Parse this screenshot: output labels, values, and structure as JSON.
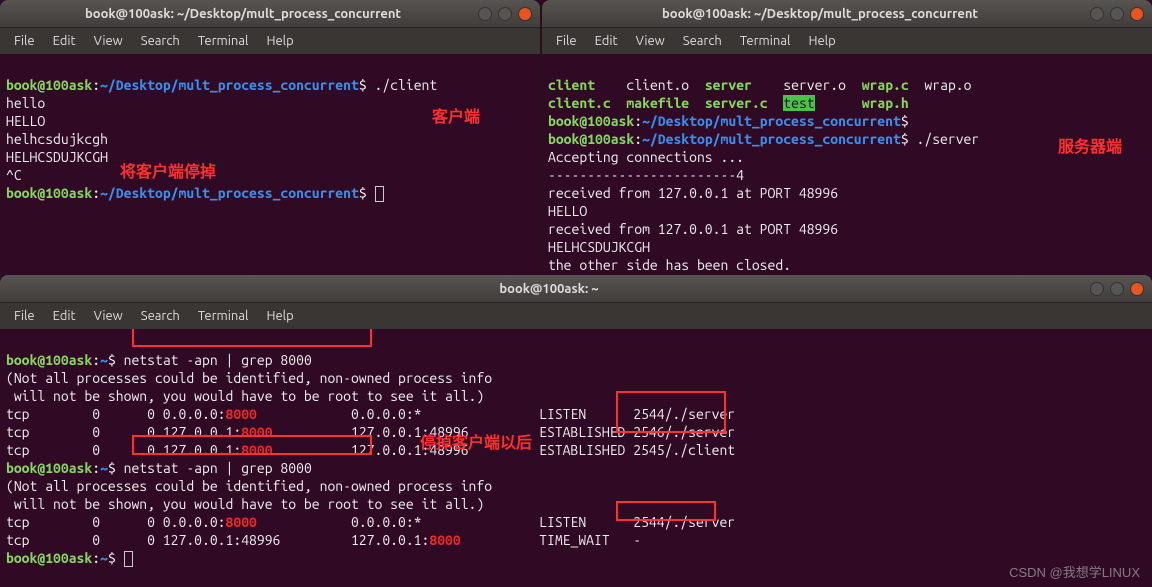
{
  "win1": {
    "title": "book@100ask: ~/Desktop/mult_process_concurrent",
    "menu": [
      "File",
      "Edit",
      "View",
      "Search",
      "Terminal",
      "Help"
    ],
    "prompt_user": "book@100ask",
    "prompt_sep": ":",
    "prompt_path": "~/Desktop/mult_process_concurrent",
    "prompt_end": "$ ",
    "cmd1": "./client",
    "l1": "hello",
    "l2": "HELLO",
    "l3": "helhcsdujkcgh",
    "l4": "HELHCSDUJKCGH",
    "l5": "^C",
    "annotation_client": "客户端",
    "annotation_stop": "将客户端停掉"
  },
  "win2": {
    "title": "book@100ask: ~/Desktop/mult_process_concurrent",
    "menu": [
      "File",
      "Edit",
      "View",
      "Search",
      "Terminal",
      "Help"
    ],
    "ls_r1_c1": "client",
    "ls_r1_c2": "client.o",
    "ls_r1_c3": "server",
    "ls_r1_c4": "server.o",
    "ls_r1_c5": "wrap.c",
    "ls_r1_c6": "wrap.o",
    "ls_r2_c1": "client.c",
    "ls_r2_c2": "makefile",
    "ls_r2_c3": "server.c",
    "ls_r2_c4": "test",
    "ls_r2_c5": "wrap.h",
    "prompt_user": "book@100ask",
    "prompt_sep": ":",
    "prompt_path": "~/Desktop/mult_process_concurrent",
    "prompt_end": "$ ",
    "cmd": "./server",
    "o1": "Accepting connections ...",
    "o2": "------------------------4",
    "o3": "received from 127.0.0.1 at PORT 48996",
    "o4": "HELLO",
    "o5": "received from 127.0.0.1 at PORT 48996",
    "o6": "HELHCSDUJKCGH",
    "o7": "the other side has been closed.",
    "annotation_server": "服务器端"
  },
  "win3": {
    "title": "book@100ask: ~",
    "menu": [
      "File",
      "Edit",
      "View",
      "Search",
      "Terminal",
      "Help"
    ],
    "prompt_user": "book@100ask",
    "prompt_sep": ":",
    "prompt_path": "~",
    "prompt_end": "$ ",
    "cmd1": "netstat -apn | grep 8000",
    "note1": "(Not all processes could be identified, non-owned process info",
    "note2": " will not be shown, you would have to be root to see it all.)",
    "r1_a": "tcp        0      0 0.0.0.0:",
    "r1_port": "8000",
    "r1_b": "            0.0.0.0:*               LISTEN      2544/./server",
    "r2_a": "tcp        0      0 127.0.0.1:",
    "r2_port": "8000",
    "r2_b": "          127.0.0.1:48996         ESTABLISHED 2546/./server",
    "r3_a": "tcp        0      0 127.0.0.1:",
    "r3_port": "8000",
    "r3_b": "          127.0.0.1:48996         ESTABLISHED 2545/./client",
    "cmd2": "netstat -apn | grep 8000",
    "ann_after": "停掉客户端以后",
    "r4_a": "tcp        0      0 0.0.0.0:",
    "r4_port": "8000",
    "r4_b": "            0.0.0.0:*               LISTEN      2544/./server",
    "r5_a": "tcp        0      0 127.0.0.1:48996         127.0.0.1:",
    "r5_port": "8000",
    "r5_b": "          TIME_WAIT   -"
  },
  "watermark": "CSDN @我想学LINUX"
}
